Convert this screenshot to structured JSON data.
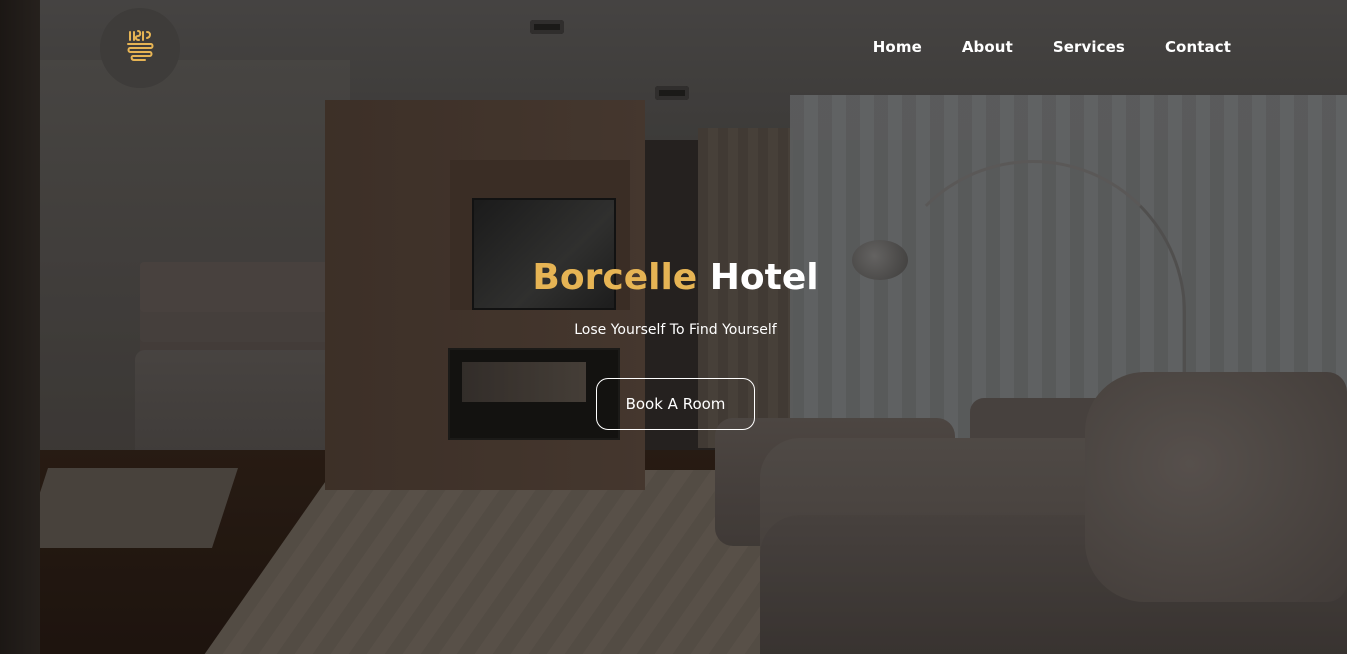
{
  "brand": {
    "logo_icon": "swirl-monogram-icon",
    "accent_color": "#e6b454"
  },
  "nav": {
    "items": [
      {
        "label": "Home"
      },
      {
        "label": "About"
      },
      {
        "label": "Services"
      },
      {
        "label": "Contact"
      }
    ]
  },
  "hero": {
    "title_accent": "Borcelle",
    "title_main": "Hotel",
    "tagline": "Lose Yourself To Find Yourself",
    "cta_label": "Book A Room",
    "background": "hotel-suite-photo"
  }
}
